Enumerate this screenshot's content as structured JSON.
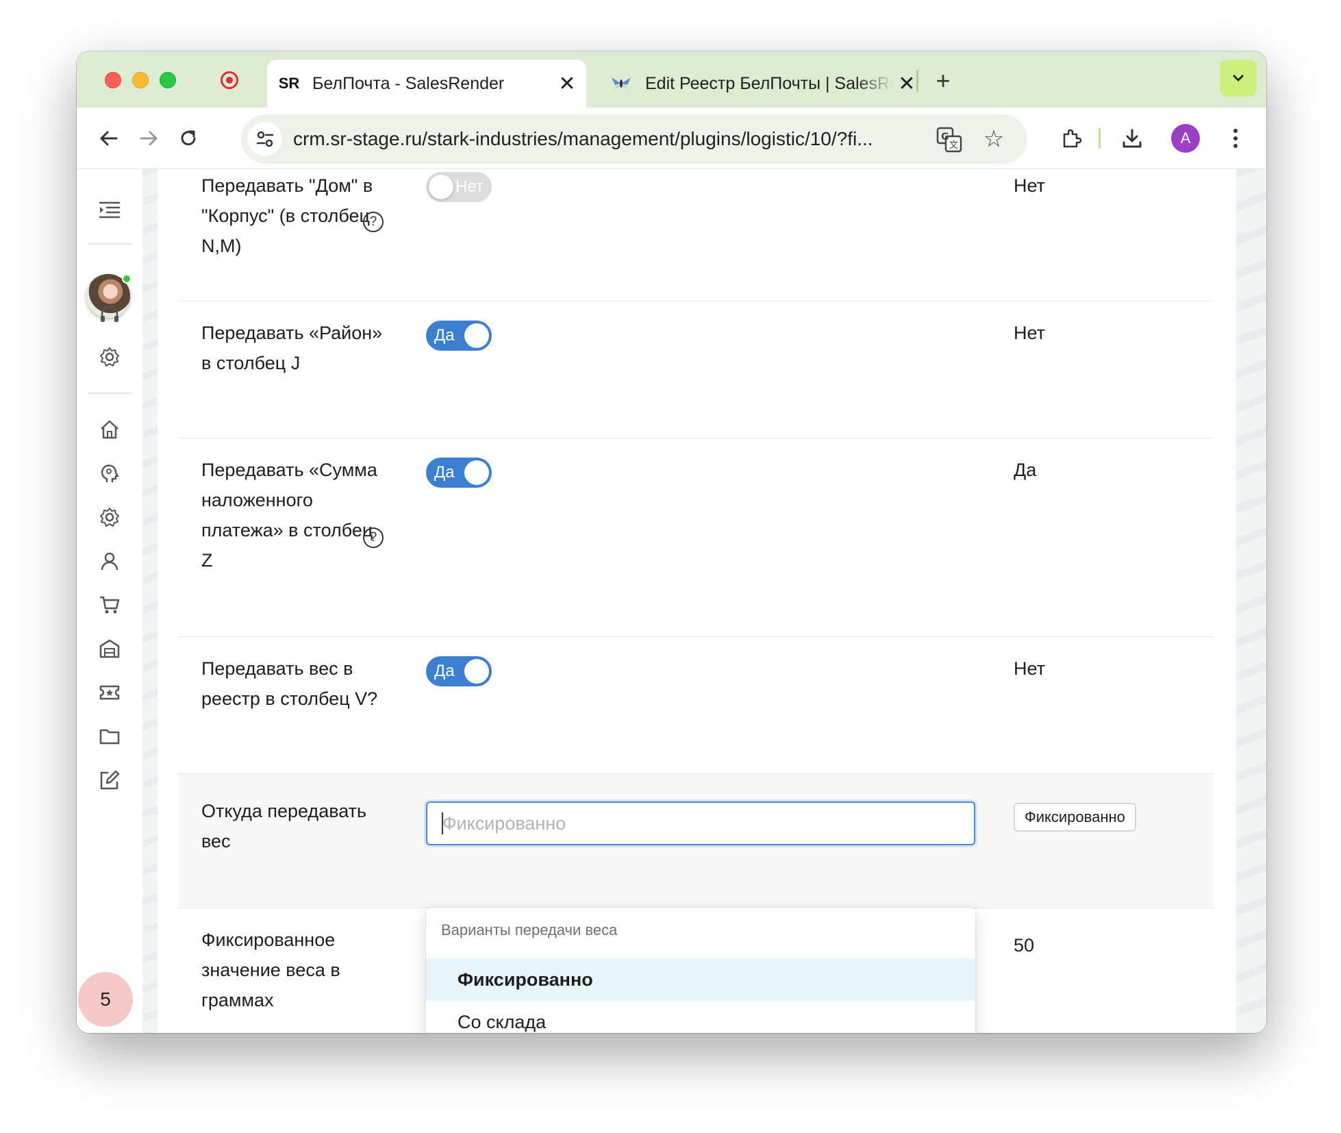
{
  "browser": {
    "tabs": [
      {
        "title": "БелПочта - SalesRender",
        "favicon": "sr-logo",
        "active": true,
        "close": "✕"
      },
      {
        "title": "Edit Реестр БелПочты | SalesRender",
        "favicon": "fly-icon",
        "active": false,
        "close": "✕"
      }
    ],
    "new_tab": "+",
    "url": "crm.sr-stage.ru/stark-industries/management/plugins/logistic/10/?fi...",
    "profile_initial": "A"
  },
  "sidebar": {
    "badge_count": "5"
  },
  "settings": {
    "rows": [
      {
        "label": "Передавать \"Дом\" в \"Корпус\" (в столбец N,M)",
        "toggle": "Нет",
        "toggle_on": false,
        "value": "Нет",
        "help": "?"
      },
      {
        "label": "Передавать «Район» в столбец J",
        "toggle": "Да",
        "toggle_on": true,
        "value": "Нет"
      },
      {
        "label": "Передавать «Сумма наложенного платежа» в столбец Z",
        "toggle": "Да",
        "toggle_on": true,
        "value": "Да",
        "help": "?"
      },
      {
        "label": "Передавать вес в реестр в столбец V?",
        "toggle": "Да",
        "toggle_on": true,
        "value": "Нет"
      },
      {
        "label": "Откуда передавать вес",
        "select_placeholder": "Фиксированно",
        "value": "Фиксированно"
      },
      {
        "label": "Фиксированное значение веса в граммах",
        "value": "50"
      }
    ]
  },
  "dropdown": {
    "group_label": "Варианты передачи веса",
    "options": [
      {
        "label": "Фиксированно",
        "selected": true
      },
      {
        "label": "Со склада",
        "selected": false
      }
    ]
  },
  "colors": {
    "toggle_on": "#3a7fd0",
    "focus_border": "#4a8ad8",
    "tabstrip": "#dcebd1",
    "option_selected_bg": "#e9f5fc"
  }
}
